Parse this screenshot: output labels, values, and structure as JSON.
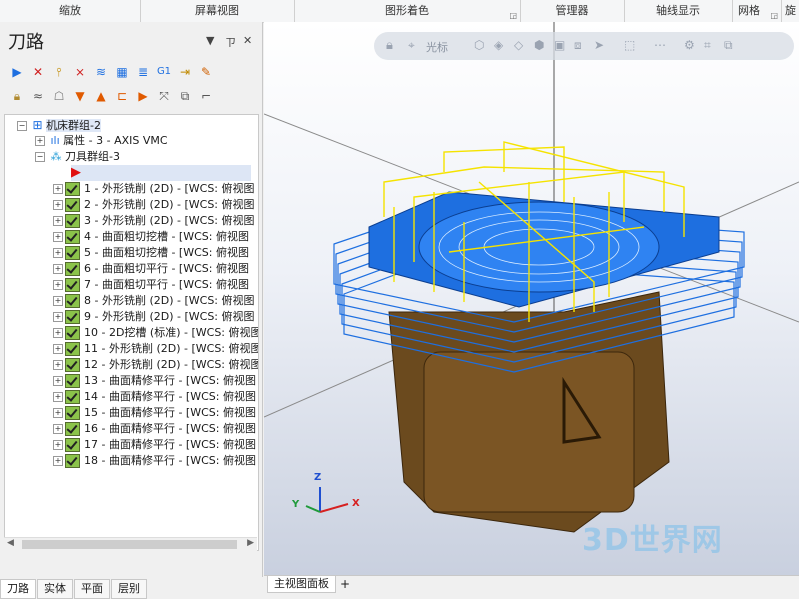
{
  "ribbon": {
    "groups": [
      {
        "label": "缩放",
        "launcher": false
      },
      {
        "label": "屏幕视图",
        "launcher": false
      },
      {
        "label": "图形着色",
        "launcher": true
      },
      {
        "label": "管理器",
        "launcher": false
      },
      {
        "label": "轴线显示",
        "launcher": false
      },
      {
        "label": "网格",
        "launcher": true
      },
      {
        "label": "旋",
        "launcher": false
      }
    ]
  },
  "panel": {
    "title": "刀路",
    "controls": {
      "menu": "▼",
      "pin": "ㄗ",
      "close": "✕"
    },
    "toolbar_row1": [
      "select-toolpath-icon",
      "deselect-toolpath-icon",
      "regen-all-icon",
      "regen-dirty-icon",
      "backplot-icon",
      "verify-icon",
      "simulate-icon",
      "post-icon",
      "g1-label-icon",
      "highfeed-icon",
      "edit-icon"
    ],
    "toolbar_row2": [
      "lock-icon",
      "wave-icon",
      "ghost-icon",
      "down-arrow-icon",
      "up-arrow-icon",
      "insert-icon",
      "move-icon",
      "collapse-icon",
      "hide-icon",
      "expand-icon"
    ],
    "g1_text": "G1"
  },
  "tree": {
    "machine_group": "机床群组-2",
    "properties": "属性 - 3 - AXIS VMC",
    "tool_group": "刀具群组-3",
    "operations": [
      "1 - 外形铣削 (2D) - [WCS: 俯视图",
      "2 - 外形铣削 (2D) - [WCS: 俯视图",
      "3 - 外形铣削 (2D) - [WCS: 俯视图",
      "4 - 曲面粗切挖槽 - [WCS: 俯视图",
      "5 - 曲面粗切挖槽 - [WCS: 俯视图",
      "6 - 曲面粗切平行 - [WCS: 俯视图",
      "7 - 曲面粗切平行 - [WCS: 俯视图",
      "8 - 外形铣削 (2D) - [WCS: 俯视图",
      "9 - 外形铣削 (2D) - [WCS: 俯视图",
      "10 - 2D挖槽 (标准) - [WCS: 俯视图",
      "11 - 外形铣削 (2D) - [WCS: 俯视图",
      "12 - 外形铣削 (2D) - [WCS: 俯视图",
      "13 - 曲面精修平行 - [WCS: 俯视图",
      "14 - 曲面精修平行 - [WCS: 俯视图",
      "15 - 曲面精修平行 - [WCS: 俯视图",
      "16 - 曲面精修平行 - [WCS: 俯视图",
      "17 - 曲面精修平行 - [WCS: 俯视图",
      "18 - 曲面精修平行 - [WCS: 俯视图"
    ]
  },
  "bottom_tabs": [
    "刀路",
    "实体",
    "平面",
    "层别"
  ],
  "viewport": {
    "toolbar_label": "光标",
    "axis_labels": {
      "x": "X",
      "y": "Y",
      "z": "Z"
    },
    "tab_label": "主视图面板",
    "add_tab": "+",
    "watermark": "3D世界网"
  },
  "colors": {
    "accent_blue": "#1e6fe0",
    "toolpath_yellow": "#f5e300",
    "part_brown": "#6b4a1e",
    "axis_x": "#d62020",
    "axis_y": "#1f9a3a",
    "axis_z": "#1f4fd0"
  }
}
